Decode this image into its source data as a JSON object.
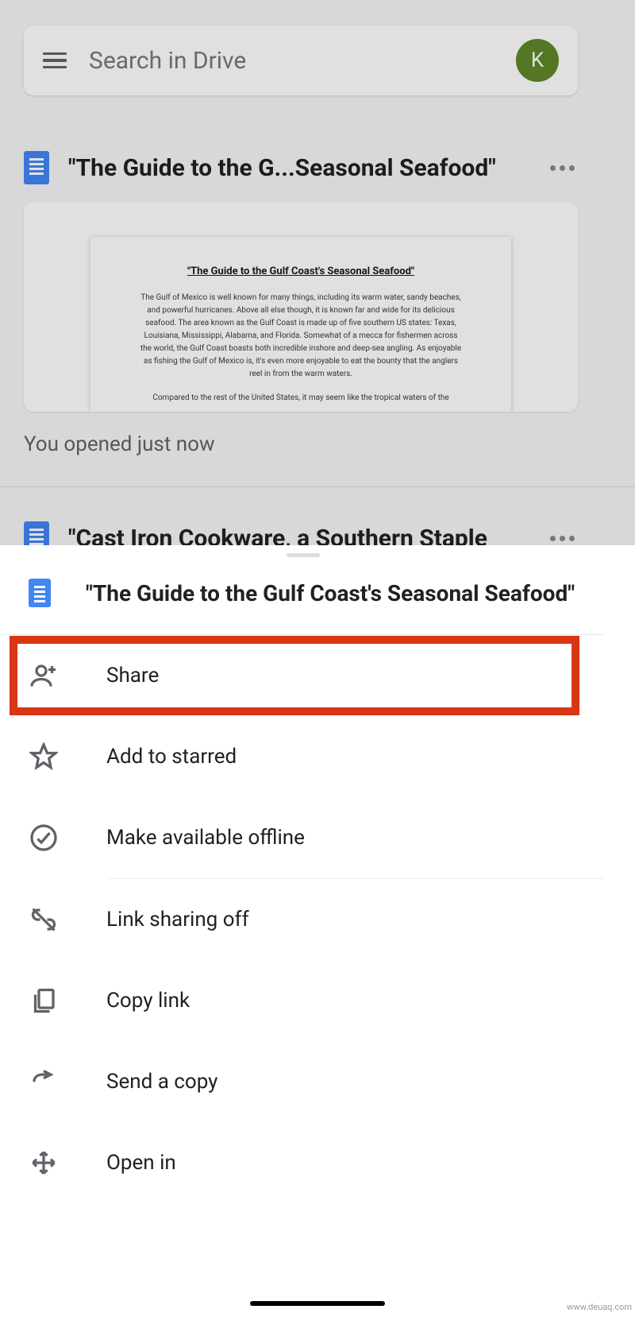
{
  "search": {
    "placeholder": "Search in Drive",
    "avatar_letter": "K"
  },
  "files": [
    {
      "title": "\"The Guide to the G...Seasonal Seafood\"",
      "opened_text": "You opened just now"
    },
    {
      "title": "\"Cast Iron Cookware, a Southern Staple"
    }
  ],
  "preview": {
    "doc_title": "\"The Guide to the Gulf Coast's Seasonal Seafood\"",
    "paragraph1": "The Gulf of Mexico is well known for many things, including its warm water, sandy beaches, and powerful hurricanes. Above all else though, it is known far and wide for its delicious seafood. The area known as the Gulf Coast is made up of five southern US states: Texas, Louisiana, Mississippi, Alabama, and Florida. Somewhat of a mecca for fishermen across the world, the Gulf Coast boasts both incredible inshore and deep-sea angling. As enjoyable as fishing the Gulf of Mexico is, it's even more enjoyable to eat the bounty that the anglers reel in from the warm waters.",
    "paragraph2": "Compared to the rest of the United States, it may seem like the tropical waters of the"
  },
  "sheet": {
    "title": "\"The Guide to the Gulf Coast's Seasonal Seafood\"",
    "items": {
      "share": "Share",
      "starred": "Add to starred",
      "offline": "Make available offline",
      "link_sharing": "Link sharing off",
      "copy_link": "Copy link",
      "send_copy": "Send a copy",
      "open_in": "Open in"
    }
  },
  "watermark": "www.deuaq.com"
}
